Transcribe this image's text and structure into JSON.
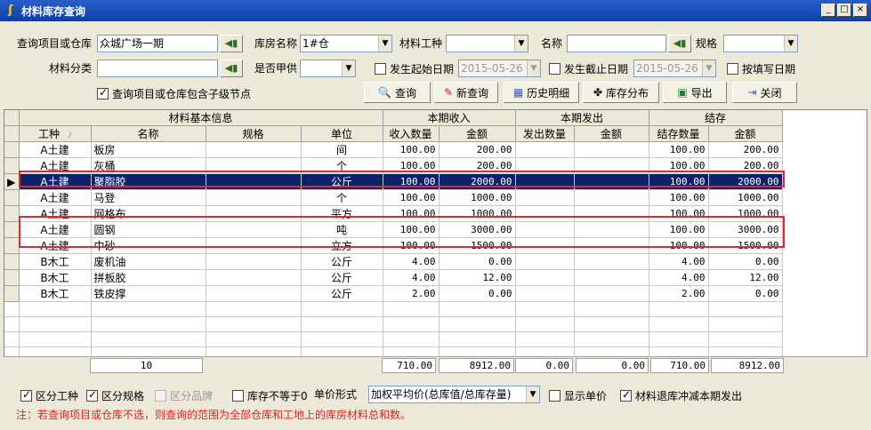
{
  "window": {
    "title": "材料库存查询",
    "buttons": [
      "_",
      "□",
      "×"
    ]
  },
  "filters": {
    "project_label": "查询项目或仓库",
    "project_value": "众城广场一期",
    "warehouse_label": "库房名称",
    "warehouse_value": "1#仓",
    "work_type_label": "材料工种",
    "work_type_value": "",
    "name_label": "名称",
    "name_value": "",
    "spec_label": "规格",
    "spec_value": "",
    "category_label": "材料分类",
    "category_value": "",
    "owner_supply_label": "是否甲供",
    "owner_supply_value": "",
    "start_date_label": "发生起始日期",
    "start_date_value": "2015-05-26",
    "end_date_label": "发生截止日期",
    "end_date_value": "2015-05-26",
    "fill_date_label": "按填写日期",
    "include_children_label": "查询项目或仓库包含子级节点"
  },
  "toolbar": {
    "query": "查询",
    "new_query": "新查询",
    "history": "历史明细",
    "distribution": "库存分布",
    "export": "导出",
    "close": "关闭"
  },
  "grid": {
    "groups": [
      "材料基本信息",
      "本期收入",
      "本期发出",
      "结存"
    ],
    "columns": [
      "工种",
      "名称",
      "规格",
      "单位",
      "收入数量",
      "金额",
      "发出数量",
      "金额",
      "结存数量",
      "金额"
    ],
    "rows": [
      [
        "A土建",
        "板房",
        "",
        "间",
        "100.00",
        "200.00",
        "",
        "",
        "100.00",
        "200.00"
      ],
      [
        "A土建",
        "灰桶",
        "",
        "个",
        "100.00",
        "200.00",
        "",
        "",
        "100.00",
        "200.00"
      ],
      [
        "A土建",
        "聚脂胶",
        "",
        "公斤",
        "100.00",
        "2000.00",
        "",
        "",
        "100.00",
        "2000.00"
      ],
      [
        "A土建",
        "马登",
        "",
        "个",
        "100.00",
        "1000.00",
        "",
        "",
        "100.00",
        "1000.00"
      ],
      [
        "A土建",
        "网格布",
        "",
        "平方",
        "100.00",
        "1000.00",
        "",
        "",
        "100.00",
        "1000.00"
      ],
      [
        "A土建",
        "圆钢",
        "",
        "吨",
        "100.00",
        "3000.00",
        "",
        "",
        "100.00",
        "3000.00"
      ],
      [
        "A土建",
        "中砂",
        "",
        "立方",
        "100.00",
        "1500.00",
        "",
        "",
        "100.00",
        "1500.00"
      ],
      [
        "B木工",
        "废机油",
        "",
        "公斤",
        "4.00",
        "0.00",
        "",
        "",
        "4.00",
        "0.00"
      ],
      [
        "B木工",
        "拼板胶",
        "",
        "公斤",
        "4.00",
        "12.00",
        "",
        "",
        "4.00",
        "12.00"
      ],
      [
        "B木工",
        "铁皮撑",
        "",
        "公斤",
        "2.00",
        "0.00",
        "",
        "",
        "2.00",
        "0.00"
      ]
    ],
    "selected_row": 2,
    "summary": {
      "count": "10",
      "in_qty": "710.00",
      "in_amt": "8912.00",
      "out_qty": "0.00",
      "out_amt": "0.00",
      "bal_qty": "710.00",
      "bal_amt": "8912.00"
    }
  },
  "options": {
    "by_work_type": "区分工种",
    "by_spec": "区分规格",
    "by_brand": "区分品牌",
    "stock_not_zero": "库存不等于0",
    "price_form_label": "单价形式",
    "price_form_value": "加权平均价(总库值/总库存量)",
    "show_unit_price": "显示单价",
    "return_offset": "材料退库冲减本期发出"
  },
  "note": "注：若查询项目或仓库不选，则查询的范围为全部仓库和工地上的库房材料总和数。",
  "colors": {
    "title_bar": "#0b3ea8",
    "selection": "#0a246a",
    "highlight_border": "#e8262b",
    "note_text": "#e81c1c"
  }
}
